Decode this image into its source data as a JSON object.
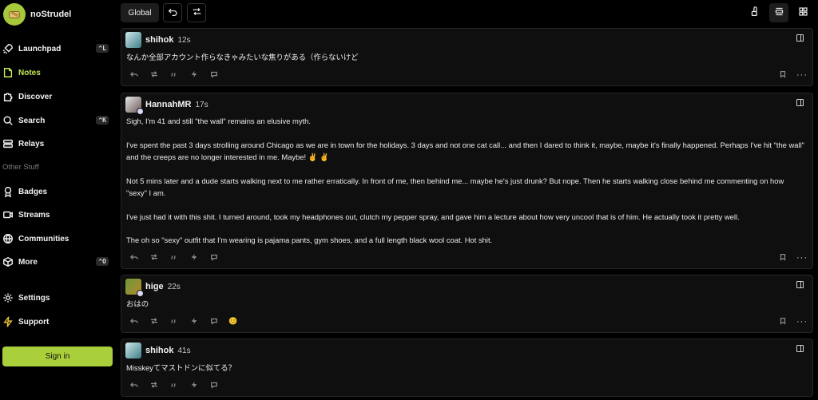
{
  "app": {
    "name": "noStrudel"
  },
  "sidebar": {
    "items": [
      {
        "key": "launchpad",
        "label": "Launchpad",
        "icon": "rocket-icon",
        "kbd": "^L"
      },
      {
        "key": "notes",
        "label": "Notes",
        "icon": "note-icon",
        "active": true
      },
      {
        "key": "discover",
        "label": "Discover",
        "icon": "puzzle-icon"
      },
      {
        "key": "search",
        "label": "Search",
        "icon": "search-icon",
        "kbd": "^K"
      },
      {
        "key": "relays",
        "label": "Relays",
        "icon": "server-icon"
      }
    ],
    "other_label": "Other Stuff",
    "other_items": [
      {
        "key": "badges",
        "label": "Badges",
        "icon": "badge-icon"
      },
      {
        "key": "streams",
        "label": "Streams",
        "icon": "video-icon"
      },
      {
        "key": "communities",
        "label": "Communities",
        "icon": "globe-icon"
      },
      {
        "key": "more",
        "label": "More",
        "icon": "cube-icon",
        "kbd": "^O"
      }
    ],
    "settings_label": "Settings",
    "support_label": "Support",
    "signin_label": "Sign in"
  },
  "topbar": {
    "feed_label": "Global"
  },
  "notes": [
    {
      "author": "shihok",
      "time": "12s",
      "avatar": "shihok",
      "content": [
        "なんか全部アカウント作らなきゃみたいな焦りがある（作らないけど"
      ]
    },
    {
      "author": "HannahMR",
      "time": "17s",
      "avatar": "hannah",
      "verified": true,
      "content": [
        "Sigh, I'm 41 and still \"the wall\" remains an elusive myth.",
        "I've spent the past 3 days strolling around Chicago as we are in town for the holidays. 3 days and not one cat call... and then I dared to think it, maybe, maybe it's finally happened. Perhaps I've hit \"the wall\" and the creeps are no longer interested in me. Maybe! ✌️ ✌️",
        "Not 5 mins later and a dude starts walking next to me rather erratically. In front of me, then behind me... maybe he's just drunk? But nope. Then he starts walking close behind me commenting on how \"sexy\" I am.",
        "I've just had it with this shit. I turned around, took my headphones out, clutch my pepper spray, and gave him a lecture about how very uncool that is of him. He actually took it pretty well.",
        "The oh so \"sexy\" outfit that I'm wearing is pajama pants, gym shoes, and a full length black wool coat. Hot shit."
      ]
    },
    {
      "author": "hige",
      "time": "22s",
      "avatar": "hige",
      "verified": true,
      "content": [
        "おはの"
      ],
      "reaction": "😊"
    },
    {
      "author": "shihok",
      "time": "41s",
      "avatar": "shihok",
      "content": [
        "Misskeyてマストドンに似てる？"
      ]
    }
  ]
}
